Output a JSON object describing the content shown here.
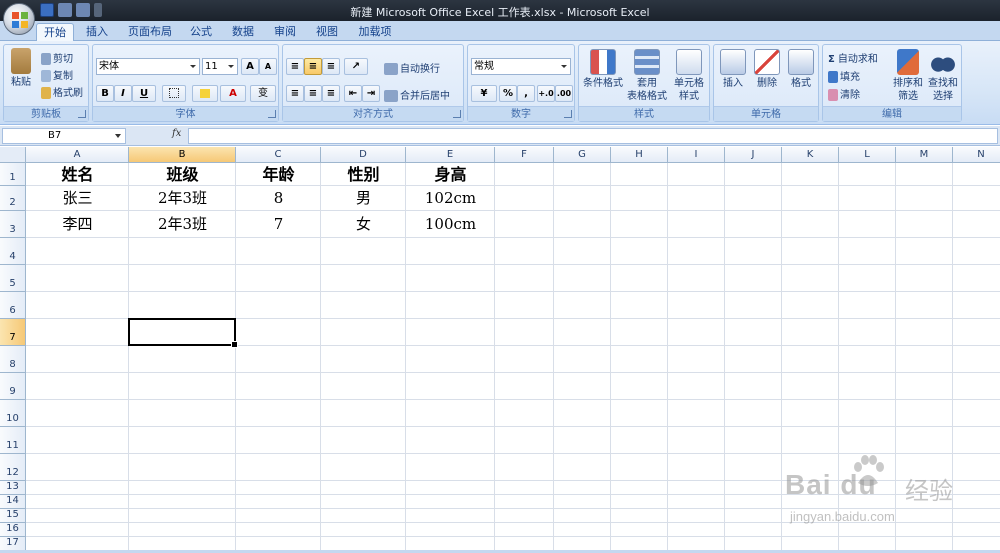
{
  "window": {
    "title": "新建 Microsoft Office Excel 工作表.xlsx - Microsoft Excel"
  },
  "tabs": [
    {
      "label": "开始",
      "active": true
    },
    {
      "label": "插入"
    },
    {
      "label": "页面布局"
    },
    {
      "label": "公式"
    },
    {
      "label": "数据"
    },
    {
      "label": "审阅"
    },
    {
      "label": "视图"
    },
    {
      "label": "加载项"
    }
  ],
  "ribbon": {
    "clipboard": {
      "label": "剪贴板",
      "paste": "粘贴",
      "cut": "剪切",
      "copy": "复制",
      "format_painter": "格式刷"
    },
    "font": {
      "label": "字体",
      "font_name": "宋体",
      "font_size": "11",
      "bold": "B",
      "italic": "I",
      "underline": "U",
      "grow": "A",
      "shrink": "A",
      "phonetic": "变"
    },
    "alignment": {
      "label": "对齐方式",
      "wrap_text": "自动换行",
      "merge_center": "合并后居中"
    },
    "number": {
      "label": "数字",
      "format": "常规",
      "percent": "%",
      "comma": ",",
      "inc_decimal": "+.0",
      "dec_decimal": ".00"
    },
    "styles": {
      "label": "样式",
      "conditional_1": "条件格式",
      "table_1": "套用",
      "table_2": "表格格式",
      "cell_1": "单元格",
      "cell_2": "样式"
    },
    "cells": {
      "label": "单元格",
      "insert": "插入",
      "delete": "删除",
      "format": "格式"
    },
    "editing": {
      "label": "编辑",
      "autosum": "自动求和",
      "fill": "填充",
      "clear": "清除",
      "sort_1": "排序和",
      "sort_2": "筛选",
      "find_1": "查找和",
      "find_2": "选择"
    }
  },
  "formula_bar": {
    "name_box": "B7",
    "fx": "fx",
    "content": ""
  },
  "columns": [
    "A",
    "B",
    "C",
    "D",
    "E",
    "F",
    "G",
    "H",
    "I",
    "J",
    "K",
    "L",
    "M",
    "N"
  ],
  "rows": [
    "1",
    "2",
    "3",
    "4",
    "5",
    "6",
    "7",
    "8",
    "9",
    "10",
    "11",
    "12",
    "13",
    "14",
    "15",
    "16",
    "17"
  ],
  "sheet": {
    "headers": [
      "姓名",
      "班级",
      "年龄",
      "性别",
      "身高"
    ],
    "data": [
      [
        "张三",
        "2年3班",
        "8",
        "男",
        "102cm"
      ],
      [
        "李四",
        "2年3班",
        "7",
        "女",
        "100cm"
      ]
    ]
  },
  "selection": {
    "cell": "B7",
    "column": "B",
    "row": "7"
  },
  "watermark": {
    "brand": "Bai du",
    "cn": "经验",
    "url": "jingyan.baidu.com"
  },
  "colors": {
    "accent": "#15428b",
    "selected_header": "#f6c876",
    "gridline": "#d8dee8"
  }
}
